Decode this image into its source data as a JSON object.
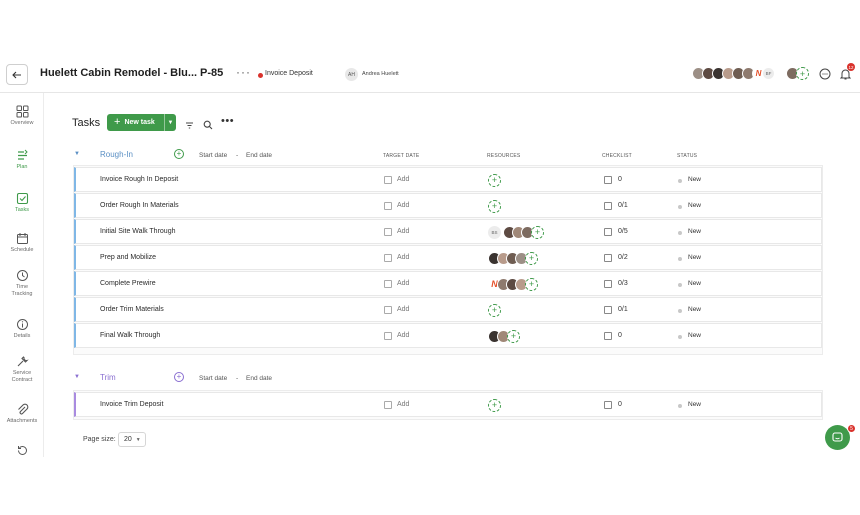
{
  "header": {
    "project_title": "Huelett Cabin Remodel - Blu...",
    "project_code": "P-85",
    "more": "···",
    "status_label": "Invoice Deposit",
    "status_color": "#d9322c",
    "owner_initials": "AH",
    "owner_name": "Andrea Huelett",
    "team_initials": "BF",
    "notification_count": "12"
  },
  "sidebar": {
    "items": [
      {
        "label": "Overview",
        "icon": "grid-icon"
      },
      {
        "label": "Plan",
        "icon": "plan-icon"
      },
      {
        "label": "Tasks",
        "icon": "tasks-icon"
      },
      {
        "label": "Schedule",
        "icon": "calendar-icon"
      },
      {
        "label": "Time Tracking",
        "icon": "clock-icon"
      },
      {
        "label": "Details",
        "icon": "info-icon"
      },
      {
        "label": "Service Contract",
        "icon": "wrench-icon"
      },
      {
        "label": "Attachments",
        "icon": "paperclip-icon"
      }
    ]
  },
  "toolbar": {
    "title": "Tasks",
    "new_task_label": "New task"
  },
  "columns": {
    "target_date": "TARGET DATE",
    "resources": "RESOURCES",
    "checklist": "CHECKLIST",
    "status": "STATUS"
  },
  "groups": [
    {
      "name": "Rough-In",
      "color": "#7fb7e6",
      "start_date": "Start date",
      "end_date": "End date",
      "tasks": [
        {
          "name": "Invoice Rough In Deposit",
          "target": "Add",
          "checklist": "0",
          "status": "New"
        },
        {
          "name": "Order Rough In Materials",
          "target": "Add",
          "checklist": "0/1",
          "status": "New"
        },
        {
          "name": "Initial Site Walk Through",
          "target": "Add",
          "checklist": "0/5",
          "status": "New",
          "resource_initials": "BS"
        },
        {
          "name": "Prep and Mobilize",
          "target": "Add",
          "checklist": "0/2",
          "status": "New"
        },
        {
          "name": "Complete Prewire",
          "target": "Add",
          "checklist": "0/3",
          "status": "New",
          "resource_initials": "N"
        },
        {
          "name": "Order Trim Materials",
          "target": "Add",
          "checklist": "0/1",
          "status": "New"
        },
        {
          "name": "Final Walk Through",
          "target": "Add",
          "checklist": "0",
          "status": "New"
        }
      ]
    },
    {
      "name": "Trim",
      "color": "#a98be0",
      "start_date": "Start date",
      "end_date": "End date",
      "tasks": [
        {
          "name": "Invoice Trim Deposit",
          "target": "Add",
          "checklist": "0",
          "status": "New"
        }
      ]
    }
  ],
  "footer": {
    "page_size_label": "Page size:",
    "page_size_value": "20"
  },
  "chat": {
    "badge": "5"
  },
  "colors": {
    "accent": "#3f9a4a",
    "alert": "#d9322c"
  }
}
